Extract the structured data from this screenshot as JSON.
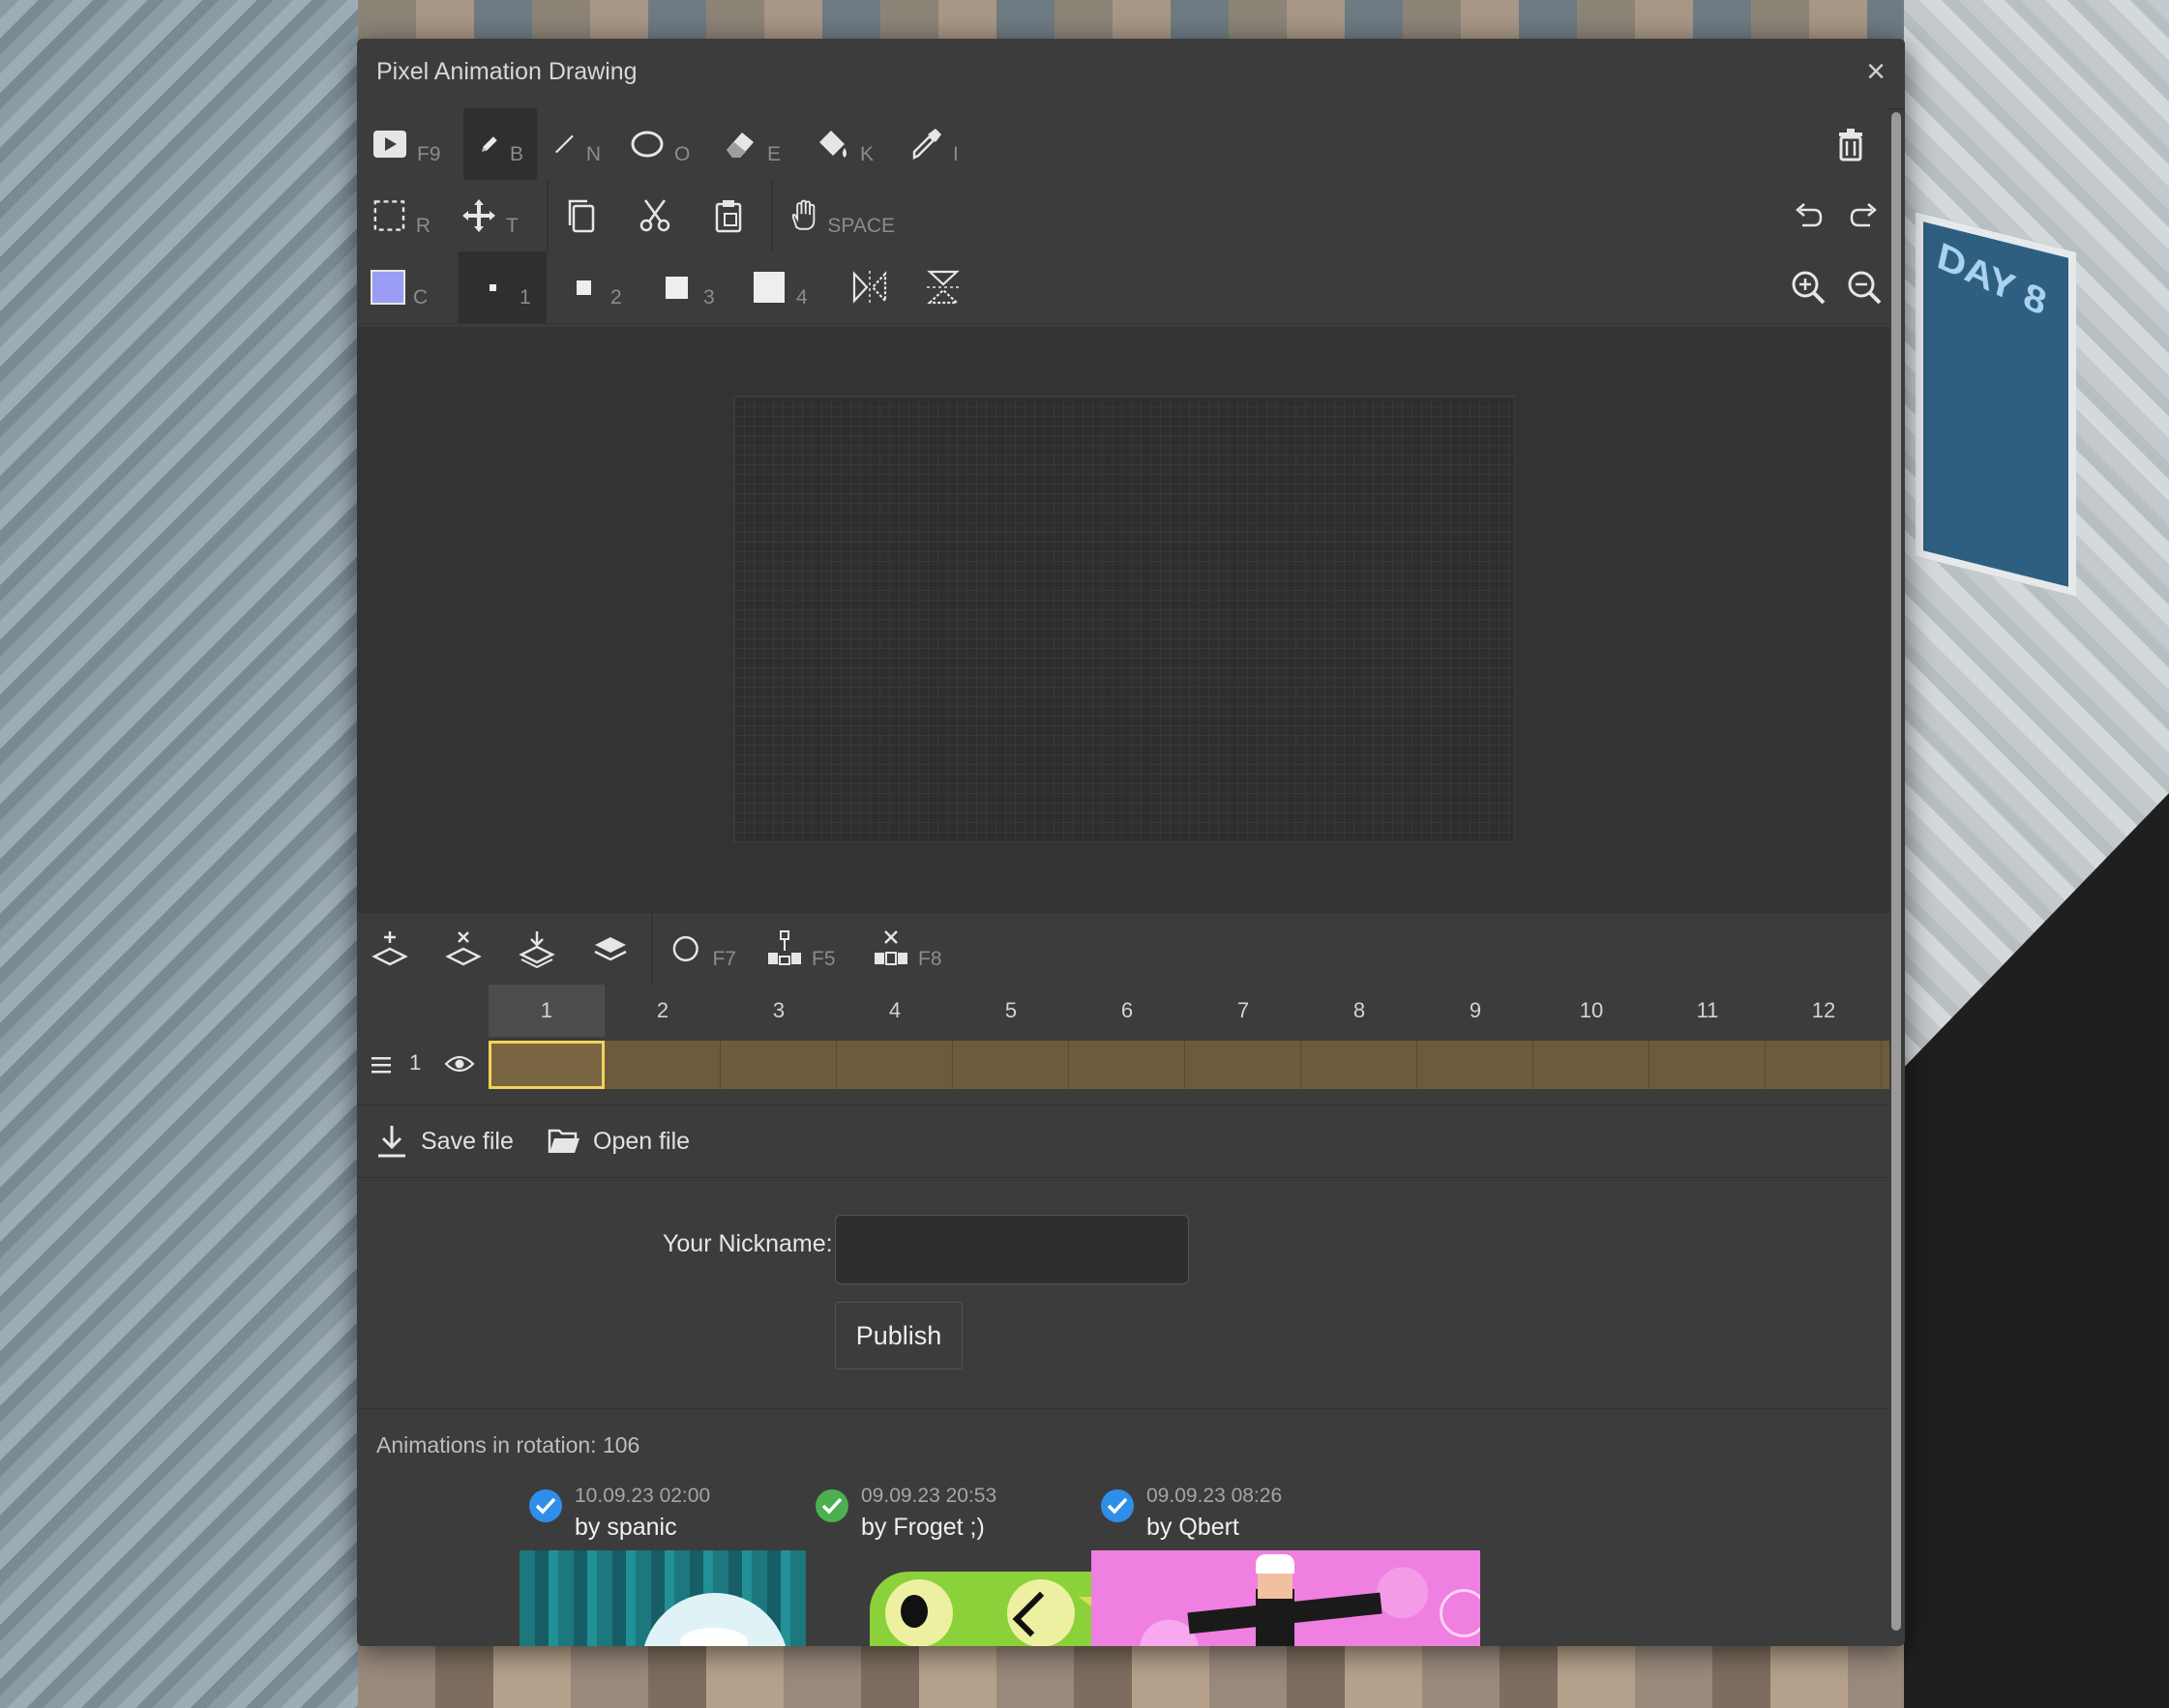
{
  "window": {
    "title": "Pixel Animation Drawing",
    "close_symbol": "×"
  },
  "toolbar_row1": {
    "play_key": "F9",
    "pencil_key": "B",
    "line_key": "N",
    "ellipse_key": "O",
    "eraser_key": "E",
    "fill_key": "K",
    "eyedropper_key": "I"
  },
  "toolbar_row2": {
    "select_key": "R",
    "move_key": "T",
    "pan_key": "SPACE"
  },
  "toolbar_row3": {
    "color_key": "C",
    "current_color": "#9a9cf5",
    "brush_sizes": [
      "1",
      "2",
      "3",
      "4"
    ],
    "selected_brush": "1"
  },
  "layer_toolbar": {
    "onion_key": "F7",
    "insert_frame_key": "F5",
    "delete_frame_key": "F8"
  },
  "timeline": {
    "frames": [
      "1",
      "2",
      "3",
      "4",
      "5",
      "6",
      "7",
      "8",
      "9",
      "10",
      "11",
      "12"
    ],
    "current_frame": "1",
    "layer_name": "1"
  },
  "file": {
    "save_label": "Save file",
    "open_label": "Open file"
  },
  "publish": {
    "nickname_label": "Your Nickname:",
    "nickname_value": "",
    "publish_label": "Publish"
  },
  "gallery": {
    "rotation_text": "Animations in rotation: 106",
    "items": [
      {
        "date": "10.09.23 02:00",
        "author": "by spanic",
        "check_color": "#2f8fe8"
      },
      {
        "date": "09.09.23 20:53",
        "author": "by Froget ;)",
        "check_color": "#4caf50"
      },
      {
        "date": "09.09.23 08:26",
        "author": "by Qbert",
        "check_color": "#2f8fe8"
      }
    ]
  },
  "colors": {
    "accent": "#f2d25a",
    "frame_track": "#6e5a3c",
    "panel": "#3c3c3c"
  }
}
